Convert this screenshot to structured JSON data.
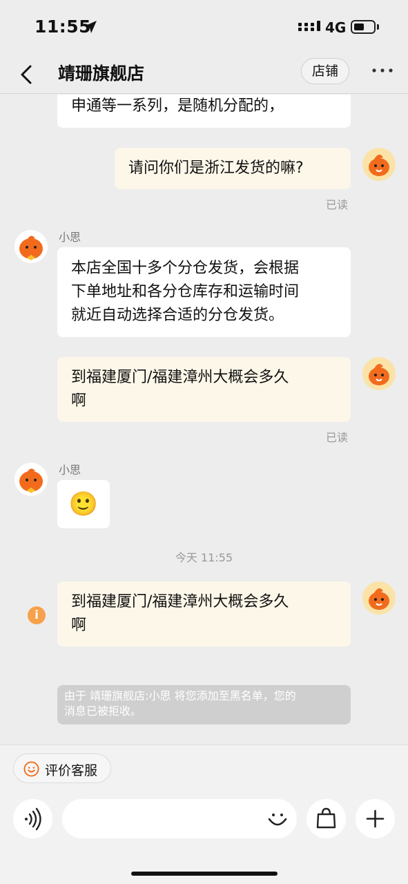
{
  "status": {
    "time": "11:55",
    "network": "4G"
  },
  "header": {
    "title": "靖珊旗舰店",
    "shop_button": "店铺"
  },
  "messages": {
    "m0_partial": "申通等一系列，是随机分配的，",
    "m1_user": "请问你们是浙江发货的嘛?",
    "m1_read": "已读",
    "m2_sender": "小思",
    "m2_line1": "本店全国十多个分仓发货，会根据",
    "m2_line2": "下单地址和各分仓库存和运输时间",
    "m2_line3": "就近自动选择合适的分仓发货。",
    "m3_line1": "到福建厦门/福建漳州大概会多久",
    "m3_line2": "啊",
    "m3_read": "已读",
    "m4_sender": "小思",
    "m4_emoji": "🙂",
    "timestamp": "今天 11:55",
    "m5_line1": "到福建厦门/福建漳州大概会多久",
    "m5_line2": "啊",
    "notice_line1": "由于 靖珊旗舰店:小思 将您添加至黑名单，您的",
    "notice_line2": "消息已被拒收。",
    "info_icon_glyph": "i"
  },
  "bottom": {
    "rate_label": "评价客服"
  },
  "colors": {
    "user_bubble": "#fdf7e9",
    "agent_bubble": "#ffffff",
    "avatar_orange": "#f26b1d",
    "info_orange": "#f7a14a"
  },
  "icons": [
    "back-chevron-icon",
    "more-dots-icon",
    "mascot-avatar",
    "info-icon",
    "smile-icon",
    "voice-icon",
    "emoji-icon",
    "bag-icon",
    "plus-icon"
  ]
}
